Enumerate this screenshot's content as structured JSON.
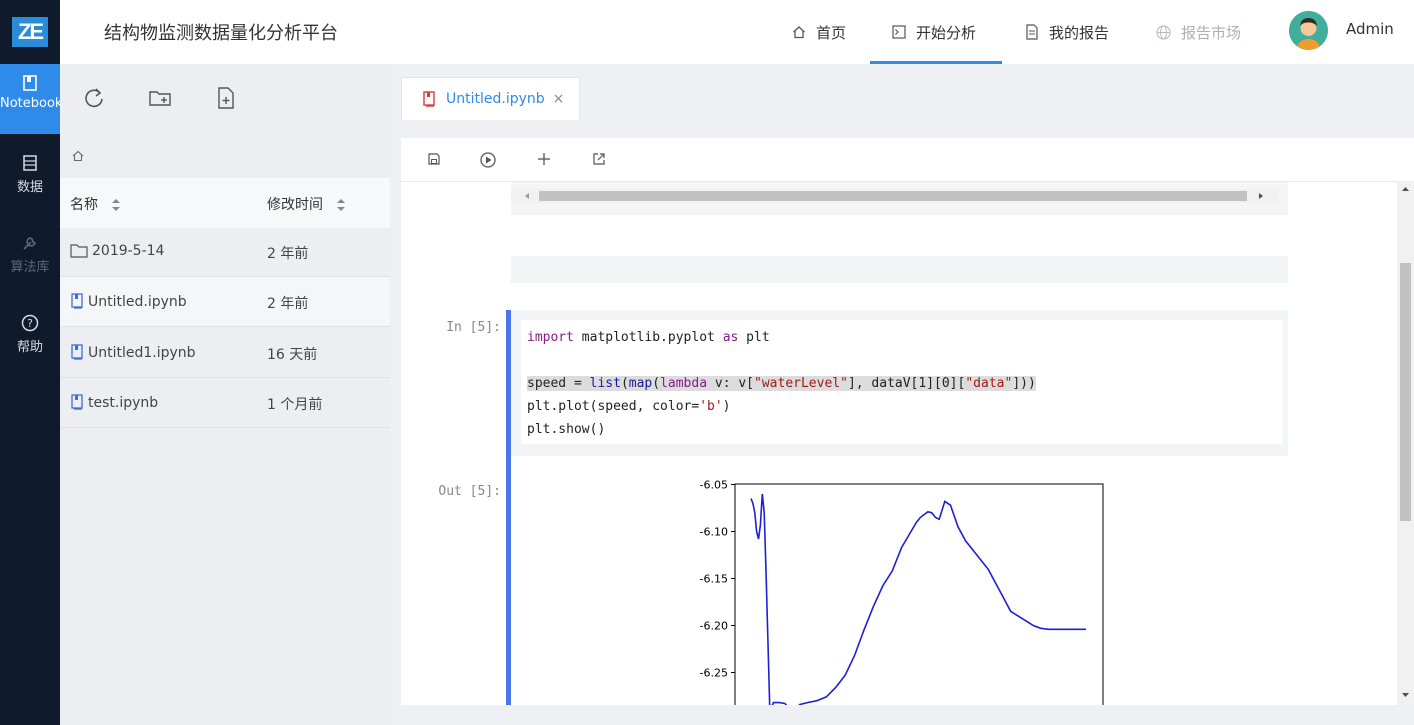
{
  "app": {
    "logo_text": "ZE",
    "title": "结构物监测数据量化分析平台"
  },
  "leftnav": {
    "items": [
      {
        "label": "Notebook",
        "icon": "notebook-icon",
        "state": "active"
      },
      {
        "label": "数据",
        "icon": "database-icon",
        "state": "normal"
      },
      {
        "label": "算法库",
        "icon": "wrench-icon",
        "state": "disabled"
      },
      {
        "label": "帮助",
        "icon": "help-icon",
        "state": "normal"
      }
    ]
  },
  "topnav": {
    "items": [
      {
        "label": "首页",
        "icon": "home-icon"
      },
      {
        "label": "开始分析",
        "icon": "terminal-icon",
        "active": true
      },
      {
        "label": "我的报告",
        "icon": "document-icon"
      },
      {
        "label": "报告市场",
        "icon": "globe-icon",
        "disabled": true
      }
    ],
    "user": "Admin"
  },
  "filepanel": {
    "toolbar": [
      "refresh-icon",
      "new-folder-icon",
      "new-file-icon"
    ],
    "breadcrumb_icon": "home-icon",
    "headers": {
      "name": "名称",
      "modified": "修改时间"
    },
    "rows": [
      {
        "name": "2019-5-14",
        "modified": "2 年前",
        "type": "folder"
      },
      {
        "name": "Untitled.ipynb",
        "modified": "2 年前",
        "type": "notebook"
      },
      {
        "name": "Untitled1.ipynb",
        "modified": "16 天前",
        "type": "notebook"
      },
      {
        "name": "test.ipynb",
        "modified": "1 个月前",
        "type": "notebook"
      }
    ]
  },
  "editor": {
    "tab_label": "Untitled.ipynb",
    "tab_close": "×",
    "toolbar": [
      "save-icon",
      "run-icon",
      "add-cell-icon",
      "export-icon"
    ],
    "cell": {
      "in_prompt": "In [5]:",
      "out_prompt": "Out [5]:"
    }
  },
  "chart_data": {
    "type": "line",
    "ylim": [
      -6.29,
      -6.05
    ],
    "yticks": [
      "-6.05",
      "-6.10",
      "-6.15",
      "-6.20",
      "-6.25"
    ],
    "color": "#1f1fd6",
    "x": [
      0,
      1,
      2,
      3,
      4,
      5,
      6,
      7,
      8,
      10,
      12,
      15,
      18,
      22,
      26,
      30,
      35,
      40,
      45,
      50,
      55,
      60,
      65,
      70,
      75,
      80,
      85,
      88,
      90,
      92,
      94,
      96,
      98,
      100,
      103,
      106,
      110,
      114,
      118,
      122,
      126,
      130,
      134,
      138,
      142,
      146,
      150,
      154,
      158,
      162,
      166,
      170,
      174,
      178
    ],
    "series": [
      {
        "values": [
          -6.065,
          -6.07,
          -6.08,
          -6.1,
          -6.108,
          -6.093,
          -6.06,
          -6.08,
          -6.145,
          -6.29,
          -6.282,
          -6.282,
          -6.283,
          -6.292,
          -6.284,
          -6.282,
          -6.28,
          -6.276,
          -6.266,
          -6.253,
          -6.232,
          -6.205,
          -6.18,
          -6.158,
          -6.142,
          -6.117,
          -6.1,
          -6.09,
          -6.085,
          -6.082,
          -6.079,
          -6.08,
          -6.085,
          -6.087,
          -6.068,
          -6.072,
          -6.095,
          -6.11,
          -6.12,
          -6.13,
          -6.14,
          -6.155,
          -6.17,
          -6.185,
          -6.19,
          -6.195,
          -6.2,
          -6.203,
          -6.204,
          -6.204,
          -6.204,
          -6.204,
          -6.204,
          -6.204
        ]
      }
    ]
  }
}
